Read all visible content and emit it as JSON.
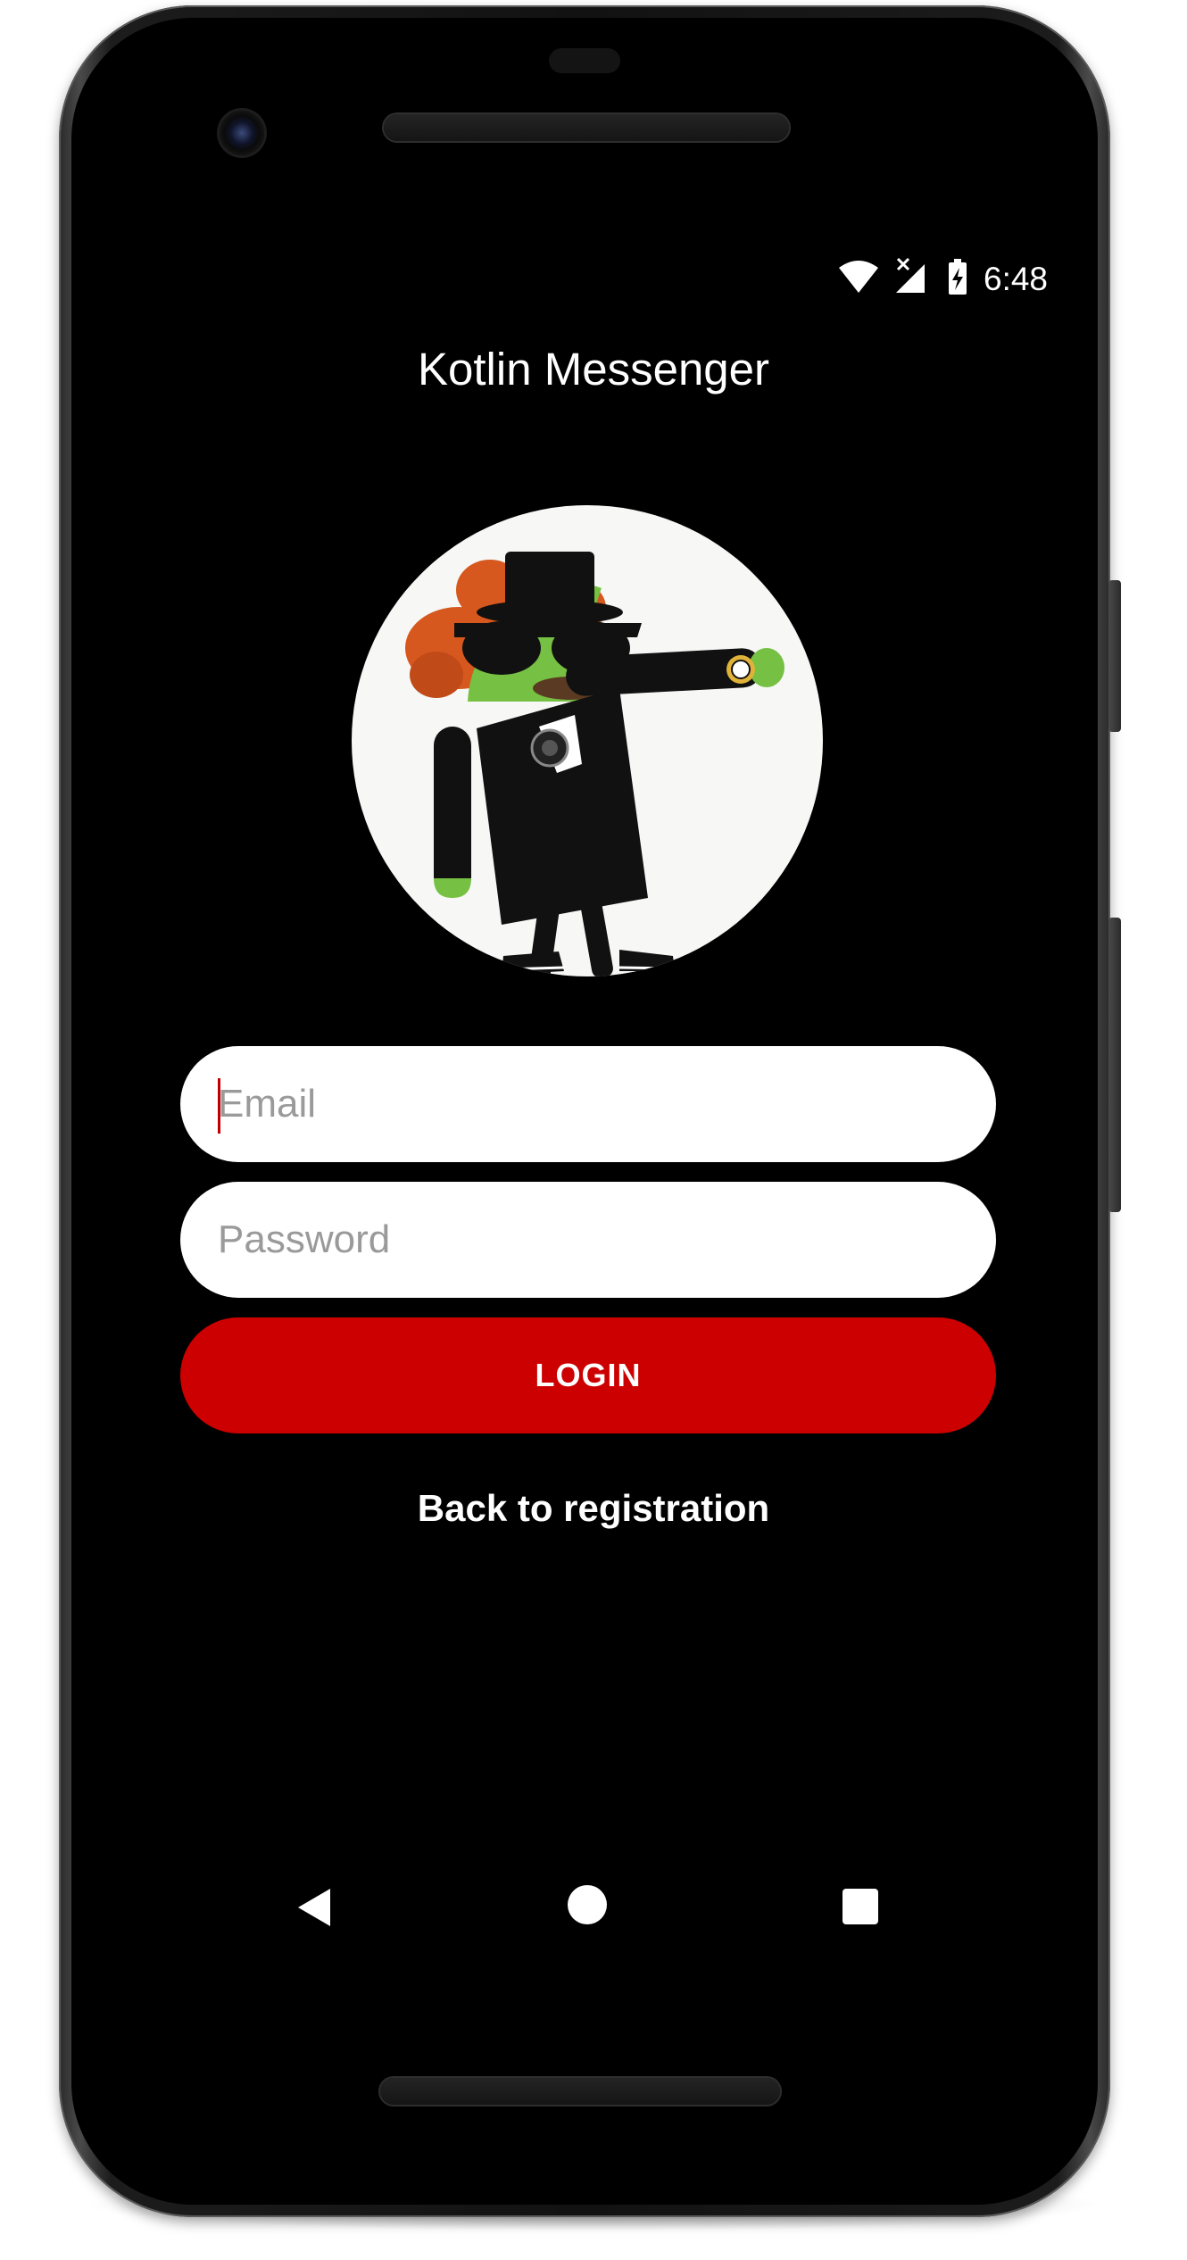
{
  "status_bar": {
    "time": "6:48",
    "icons": [
      "wifi-icon",
      "cell-signal-icon",
      "battery-charging-icon"
    ]
  },
  "app": {
    "title": "Kotlin Messenger"
  },
  "avatar": {
    "icon": "android-mascot-avatar"
  },
  "form": {
    "email_placeholder": "Email",
    "email_value": "",
    "password_placeholder": "Password",
    "password_value": "",
    "login_label": "LOGIN",
    "back_link_label": "Back to registration"
  },
  "nav_bar": {
    "icons": [
      "back-triangle-icon",
      "home-circle-icon",
      "recents-square-icon"
    ]
  },
  "colors": {
    "background": "#000000",
    "accent": "#cc0000",
    "field": "#ffffff",
    "text": "#ffffff"
  }
}
